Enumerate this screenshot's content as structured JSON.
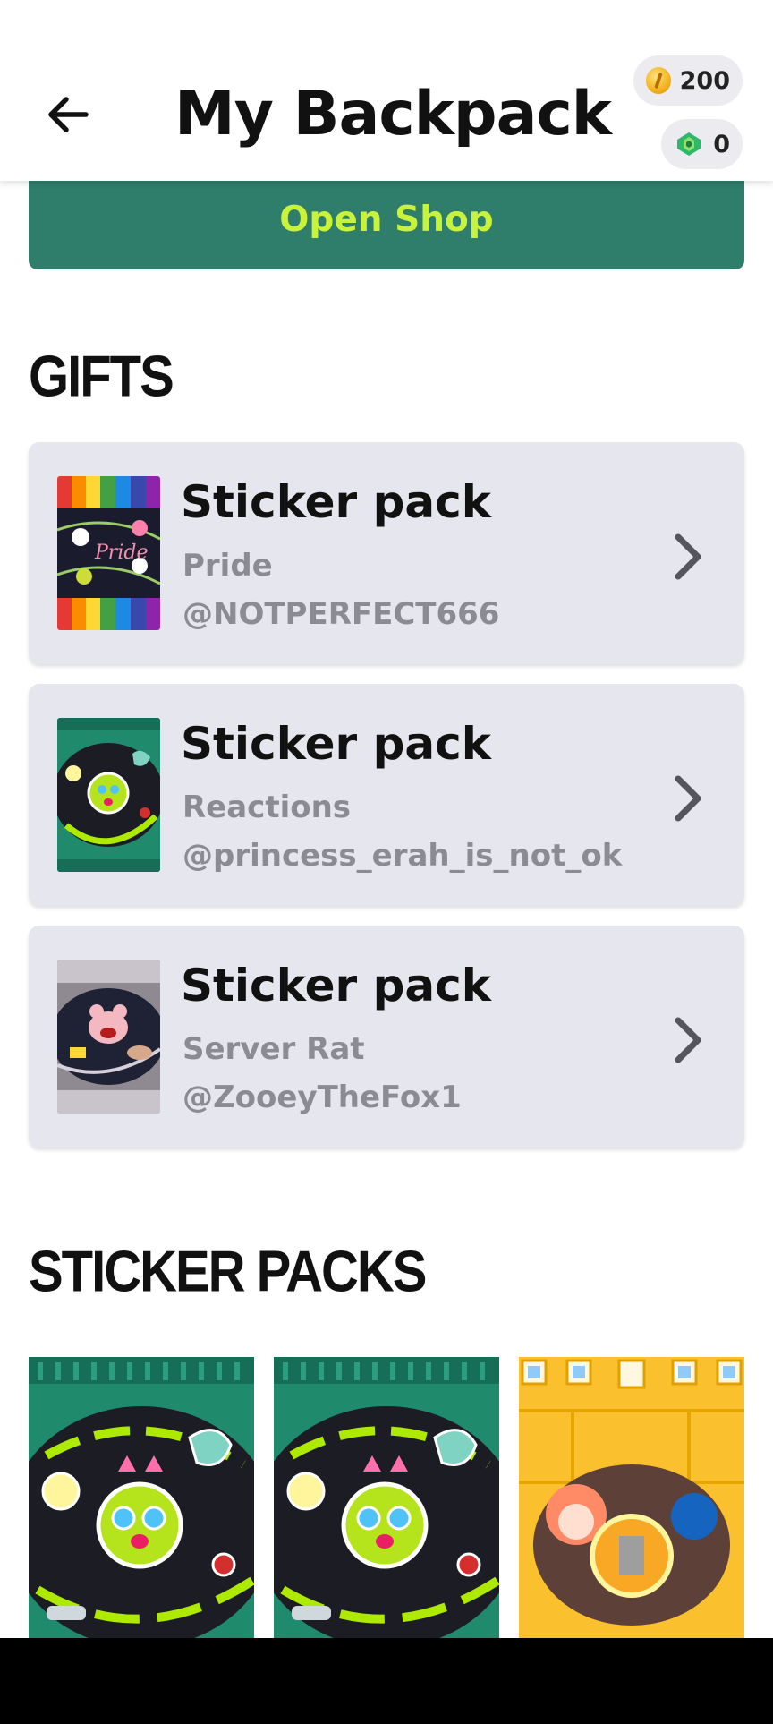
{
  "header": {
    "title": "My Backpack",
    "back_icon": "arrow-left-icon",
    "coins": "200",
    "gems": "0"
  },
  "shop": {
    "label": "Open Shop"
  },
  "gifts": {
    "title": "GIFTS",
    "items": [
      {
        "name": "Sticker pack",
        "subtitle": "Pride",
        "user": "@NOTPERFECT666"
      },
      {
        "name": "Sticker pack",
        "subtitle": "Reactions",
        "user": "@princess_erah_is_not_ok"
      },
      {
        "name": "Sticker pack",
        "subtitle": "Server Rat",
        "user": "@ZooeyTheFox1"
      }
    ]
  },
  "sticker_packs": {
    "title": "STICKER PACKS"
  },
  "colors": {
    "accent": "#2e7e6b",
    "accent_text": "#c9f23a",
    "card": "#e6e6ee"
  }
}
